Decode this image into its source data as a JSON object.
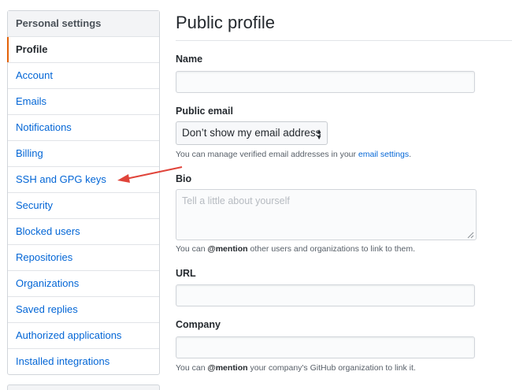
{
  "sidebar": {
    "heading": "Personal settings",
    "items": [
      {
        "label": "Profile",
        "selected": true
      },
      {
        "label": "Account"
      },
      {
        "label": "Emails"
      },
      {
        "label": "Notifications"
      },
      {
        "label": "Billing"
      },
      {
        "label": "SSH and GPG keys"
      },
      {
        "label": "Security"
      },
      {
        "label": "Blocked users"
      },
      {
        "label": "Repositories"
      },
      {
        "label": "Organizations"
      },
      {
        "label": "Saved replies"
      },
      {
        "label": "Authorized applications"
      },
      {
        "label": "Installed integrations"
      }
    ]
  },
  "main": {
    "title": "Public profile",
    "name": {
      "label": "Name",
      "value": ""
    },
    "public_email": {
      "label": "Public email",
      "selected": "Don’t show my email address",
      "note_prefix": "You can manage verified email addresses in your ",
      "note_link": "email settings",
      "note_suffix": "."
    },
    "bio": {
      "label": "Bio",
      "placeholder": "Tell a little about yourself",
      "note_prefix": "You can ",
      "note_mention": "@mention",
      "note_suffix": " other users and organizations to link to them."
    },
    "url": {
      "label": "URL",
      "value": ""
    },
    "company": {
      "label": "Company",
      "value": "",
      "note_prefix": "You can ",
      "note_mention": "@mention",
      "note_suffix": " your company's GitHub organization to link it."
    }
  },
  "colors": {
    "link": "#0366d6",
    "selected_marker": "#e36209",
    "annotation_arrow": "#e0443a"
  },
  "icons": {
    "select_arrows": "updown-caret-icon",
    "annotation": "red-arrow-annotation"
  }
}
